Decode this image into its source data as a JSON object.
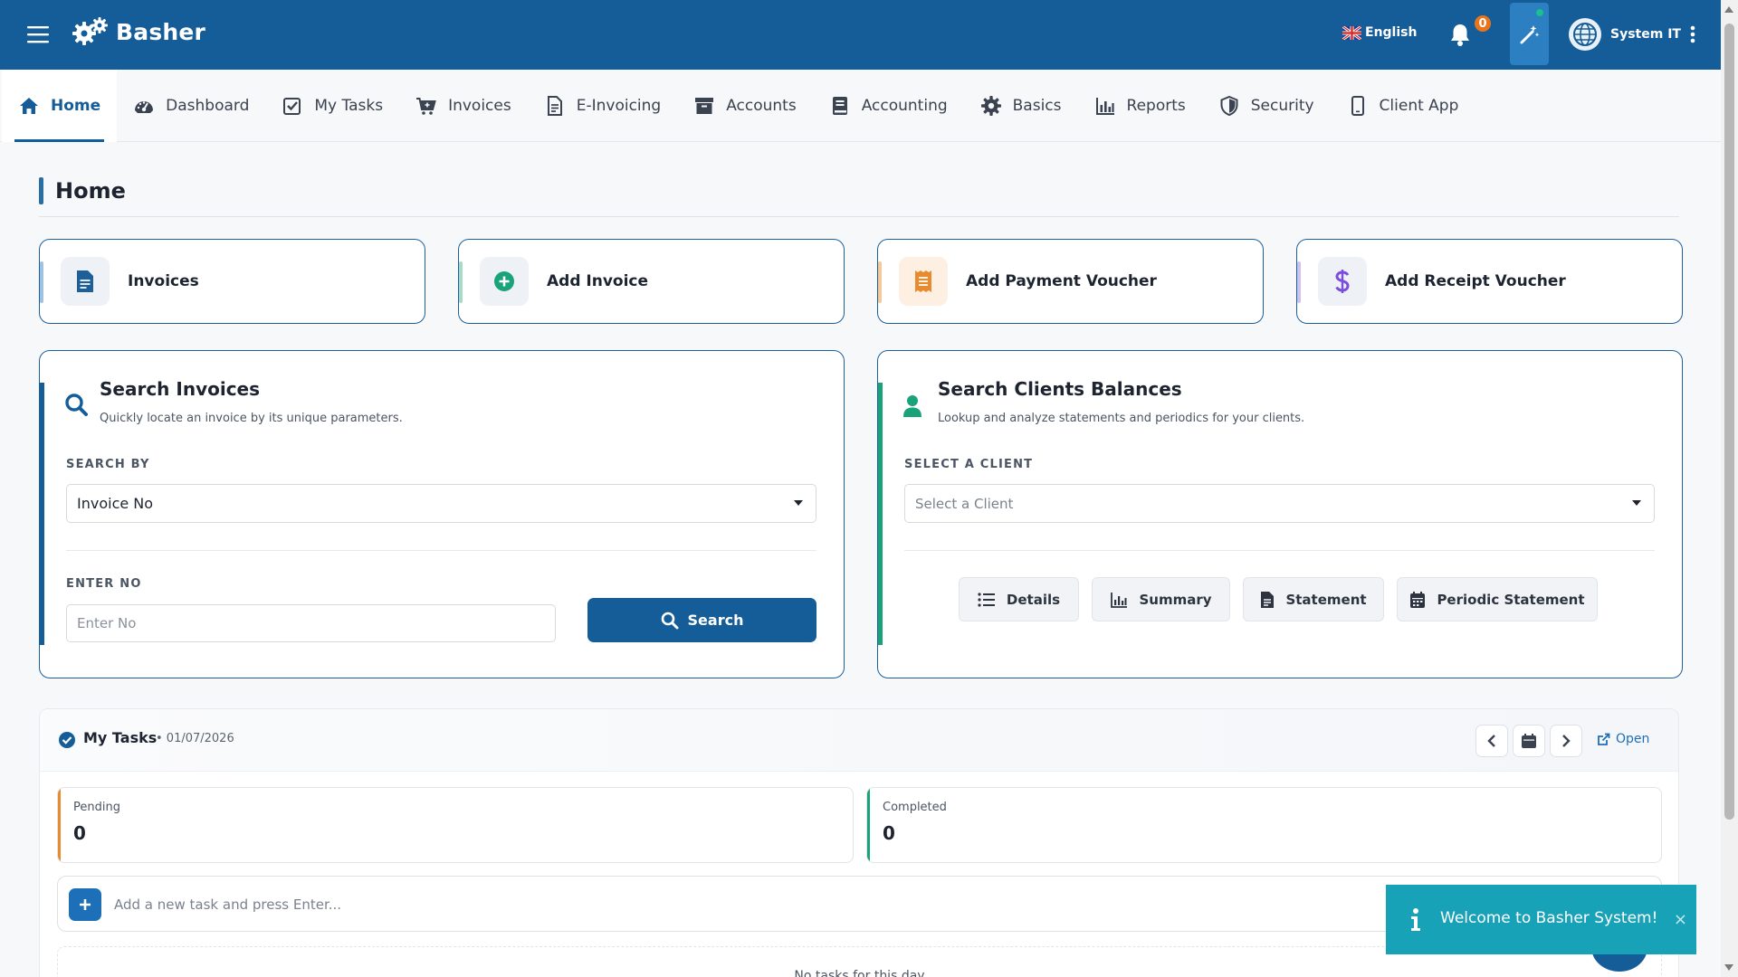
{
  "header": {
    "brand": "Basher",
    "language": "English",
    "notifications_count": "0",
    "user_name": "System IT"
  },
  "nav": {
    "items": [
      {
        "label": "Home",
        "icon": "home-icon",
        "active": true
      },
      {
        "label": "Dashboard",
        "icon": "gauge-icon"
      },
      {
        "label": "My Tasks",
        "icon": "checkbox-icon"
      },
      {
        "label": "Invoices",
        "icon": "cart-icon"
      },
      {
        "label": "E-Invoicing",
        "icon": "document-icon"
      },
      {
        "label": "Accounts",
        "icon": "archive-box-icon"
      },
      {
        "label": "Accounting",
        "icon": "book-icon"
      },
      {
        "label": "Basics",
        "icon": "gear-icon"
      },
      {
        "label": "Reports",
        "icon": "bar-chart-icon"
      },
      {
        "label": "Security",
        "icon": "shield-icon"
      },
      {
        "label": "Client App",
        "icon": "mobile-icon"
      }
    ]
  },
  "page": {
    "title": "Home"
  },
  "quick_cards": [
    {
      "label": "Invoices",
      "icon": "document-icon",
      "color": "#1d5f98"
    },
    {
      "label": "Add Invoice",
      "icon": "plus-circle-icon",
      "color": "#1aa37a"
    },
    {
      "label": "Add Payment Voucher",
      "icon": "receipt-icon",
      "color": "#e88b2e"
    },
    {
      "label": "Add Receipt Voucher",
      "icon": "dollar-icon",
      "color": "#7c4ddb"
    }
  ],
  "search_invoices": {
    "title": "Search Invoices",
    "subtitle": "Quickly locate an invoice by its unique parameters.",
    "search_by_label": "SEARCH BY",
    "search_by_value": "Invoice No",
    "enter_no_label": "ENTER NO",
    "enter_no_placeholder": "Enter No",
    "search_button": "Search"
  },
  "search_clients": {
    "title": "Search Clients Balances",
    "subtitle": "Lookup and analyze statements and periodics for your clients.",
    "select_label": "SELECT A CLIENT",
    "select_placeholder": "Select a Client",
    "buttons": [
      "Details",
      "Summary",
      "Statement",
      "Periodic Statement"
    ]
  },
  "tasks": {
    "title": "My Tasks",
    "date": "• 01/07/2026",
    "open_label": "Open",
    "pending_label": "Pending",
    "pending_value": "0",
    "completed_label": "Completed",
    "completed_value": "0",
    "add_placeholder": "Add a new task and press Enter...",
    "empty_text": "No tasks for this day"
  },
  "toast": {
    "message": "Welcome to Basher System!",
    "close": "×"
  },
  "colors": {
    "primary": "#155d99",
    "success": "#1aa37a",
    "warning": "#e88b2e",
    "info": "#17a2b8"
  }
}
